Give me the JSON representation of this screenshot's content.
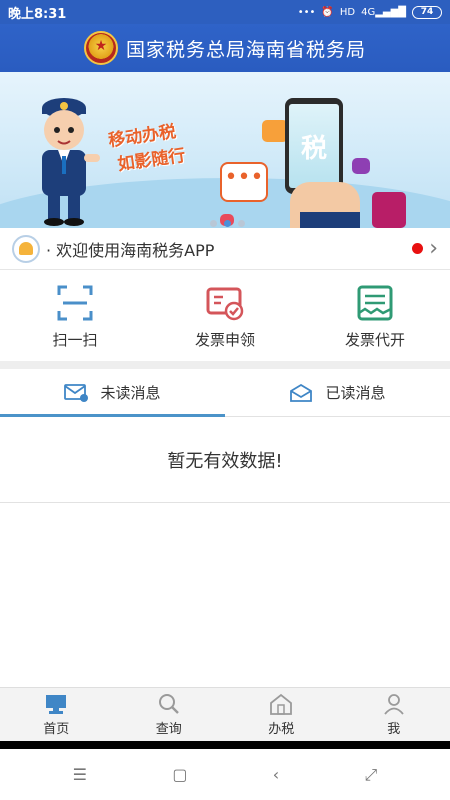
{
  "status_bar": {
    "time": "晚上8:31",
    "signal": "4G",
    "battery": "74"
  },
  "header": {
    "title": "国家税务总局海南省税务局",
    "emblem_icon": "national-emblem-icon"
  },
  "banner": {
    "slogan_line1": "移动办税",
    "slogan_line2": "如影随行",
    "phone_text": "税",
    "carousel_total": 3,
    "carousel_active": 2
  },
  "notice": {
    "text": "· 欢迎使用海南税务APP",
    "icon": "bell-icon"
  },
  "actions": [
    {
      "label": "扫一扫",
      "icon": "scan-icon",
      "color": "#4a8fc9"
    },
    {
      "label": "发票申领",
      "icon": "invoice-apply-icon",
      "color": "#d4555a"
    },
    {
      "label": "发票代开",
      "icon": "invoice-issue-icon",
      "color": "#2f9a74"
    }
  ],
  "tabs": [
    {
      "label": "未读消息",
      "icon": "unread-mail-icon",
      "active": true
    },
    {
      "label": "已读消息",
      "icon": "read-mail-icon",
      "active": false
    }
  ],
  "empty_message": "暂无有效数据!",
  "bottom_nav": [
    {
      "label": "首页",
      "icon": "home-screen-icon",
      "active": true
    },
    {
      "label": "查询",
      "icon": "search-icon",
      "active": false
    },
    {
      "label": "办税",
      "icon": "tax-office-icon",
      "active": false
    },
    {
      "label": "我",
      "icon": "user-icon",
      "active": false
    }
  ],
  "colors": {
    "header_blue": "#2d5fbf",
    "tab_underline": "#4b93c9",
    "notice_dot": "#e81010"
  }
}
